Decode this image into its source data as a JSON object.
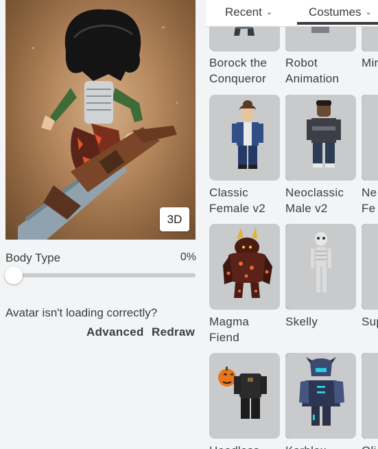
{
  "preview": {
    "view_toggle": "3D"
  },
  "body_type": {
    "label": "Body Type",
    "value": "0%",
    "percent": 0
  },
  "loading": {
    "question": "Avatar isn't loading correctly?",
    "advanced": "Advanced",
    "redraw": "Redraw"
  },
  "tabs": [
    {
      "label": "Recent"
    },
    {
      "label": "Costumes",
      "active": true
    }
  ],
  "rows": [
    {
      "items": [
        {
          "line1": "Borock the",
          "line2": "Conqueror"
        },
        {
          "line1": "Robot",
          "line2": "Animation"
        },
        {
          "line1": "Mir",
          "line2": ""
        }
      ]
    },
    {
      "items": [
        {
          "line1": "Classic",
          "line2": "Female v2"
        },
        {
          "line1": "Neoclassic",
          "line2": "Male v2"
        },
        {
          "line1": "Ne",
          "line2": "Fe"
        }
      ]
    },
    {
      "items": [
        {
          "line1": "Magma",
          "line2": "Fiend"
        },
        {
          "line1": "Skelly",
          "line2": ""
        },
        {
          "line1": "Sup",
          "line2": ""
        }
      ]
    },
    {
      "items": [
        {
          "line1": "Headless",
          "line2": ""
        },
        {
          "line1": "Korblox",
          "line2": ""
        },
        {
          "line1": "Oli",
          "line2": ""
        }
      ]
    }
  ]
}
